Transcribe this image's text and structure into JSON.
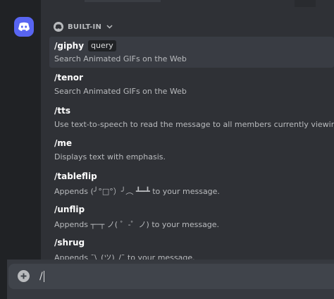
{
  "section": {
    "label": "BUILT-IN"
  },
  "commands": [
    {
      "name": "/giphy",
      "option": "query",
      "description": "Search Animated GIFs on the Web"
    },
    {
      "name": "/tenor",
      "description": "Search Animated GIFs on the Web"
    },
    {
      "name": "/tts",
      "description": "Use text-to-speech to read the message to all members currently viewing the cha"
    },
    {
      "name": "/me",
      "description": "Displays text with emphasis."
    },
    {
      "name": "/tableflip",
      "description": "Appends (╯°□°）╯︵ ┻━┻ to your message."
    },
    {
      "name": "/unflip",
      "description": "Appends ┬─┬ ノ( ゜-゜ノ) to your message."
    },
    {
      "name": "/shrug",
      "description": "Appends ¯\\_(ツ)_/¯ to your message."
    }
  ],
  "chat": {
    "input_value": "/"
  },
  "icons": {
    "guild": "discord-logo-icon",
    "section": "discord-mini-icon",
    "chevron": "chevron-down-icon",
    "add": "add-circle-icon"
  },
  "colors": {
    "accent": "#5865f2",
    "background": "#36393f",
    "popup": "#2f3136",
    "selected": "#393c43"
  }
}
